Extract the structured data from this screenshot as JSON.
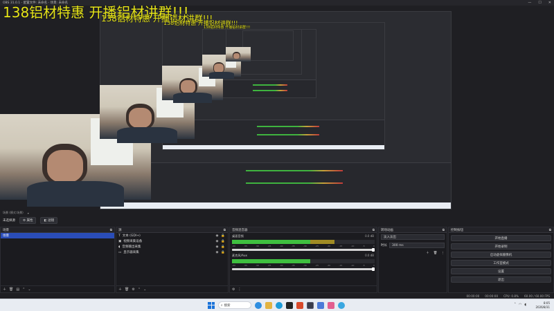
{
  "window": {
    "title": "OBS 31.0.1 - 配置文件: 未命名 - 场景: 未命名"
  },
  "overlay": {
    "text": "138铝材特惠 开播铝材讲群!!!"
  },
  "preview": {
    "mini_label": "源/场景"
  },
  "statusline": {
    "left": "场景 (模式:场景)",
    "right_label": "▾"
  },
  "scene_toolbar": {
    "label": "未选择源",
    "props": "属性",
    "filters": "滤镜"
  },
  "scenes": {
    "title": "场景",
    "items": [
      {
        "label": "场景",
        "selected": true
      }
    ]
  },
  "sources": {
    "title": "源",
    "items": [
      {
        "label": "文本 (GDI+)",
        "icon": "text-icon"
      },
      {
        "label": "视频采集设备",
        "icon": "camera-icon"
      },
      {
        "label": "音频输出采集",
        "icon": "speaker-icon"
      },
      {
        "label": "显示器采集",
        "icon": "monitor-icon"
      }
    ]
  },
  "mixer": {
    "title": "音频混音器",
    "channels": [
      {
        "name": "桌面音频",
        "db": "0.0 dB",
        "level": 0.72
      },
      {
        "name": "麦克风/Aux",
        "db": "0.0 dB",
        "level": 0.55
      }
    ],
    "ticks": [
      "-60",
      "-55",
      "-50",
      "-45",
      "-40",
      "-35",
      "-30",
      "-25",
      "-20",
      "-15",
      "-10",
      "-5",
      "0"
    ]
  },
  "transitions": {
    "title": "转场动画",
    "selected": "淡入淡出",
    "duration_label": "时长",
    "duration": "300 ms"
  },
  "controls": {
    "title": "控制按钮",
    "buttons": [
      "开始直播",
      "开始录制",
      "启动虚拟摄像机",
      "工作室模式",
      "设置",
      "退出"
    ]
  },
  "obs_status": {
    "cpu": "CPU: 0.8%",
    "fps": "60.00 / 60.00 FPS",
    "rec": "00:00:00",
    "live": "00:00:00"
  },
  "taskbar": {
    "search": "搜索",
    "time": "8:05",
    "date": "2026/8/31",
    "colors": {
      "obs": "#3b3d4a",
      "chrome": "#2f8ee0",
      "folder": "#e3b341",
      "game": "#d94a2b",
      "edge": "#1d9bd7"
    }
  }
}
